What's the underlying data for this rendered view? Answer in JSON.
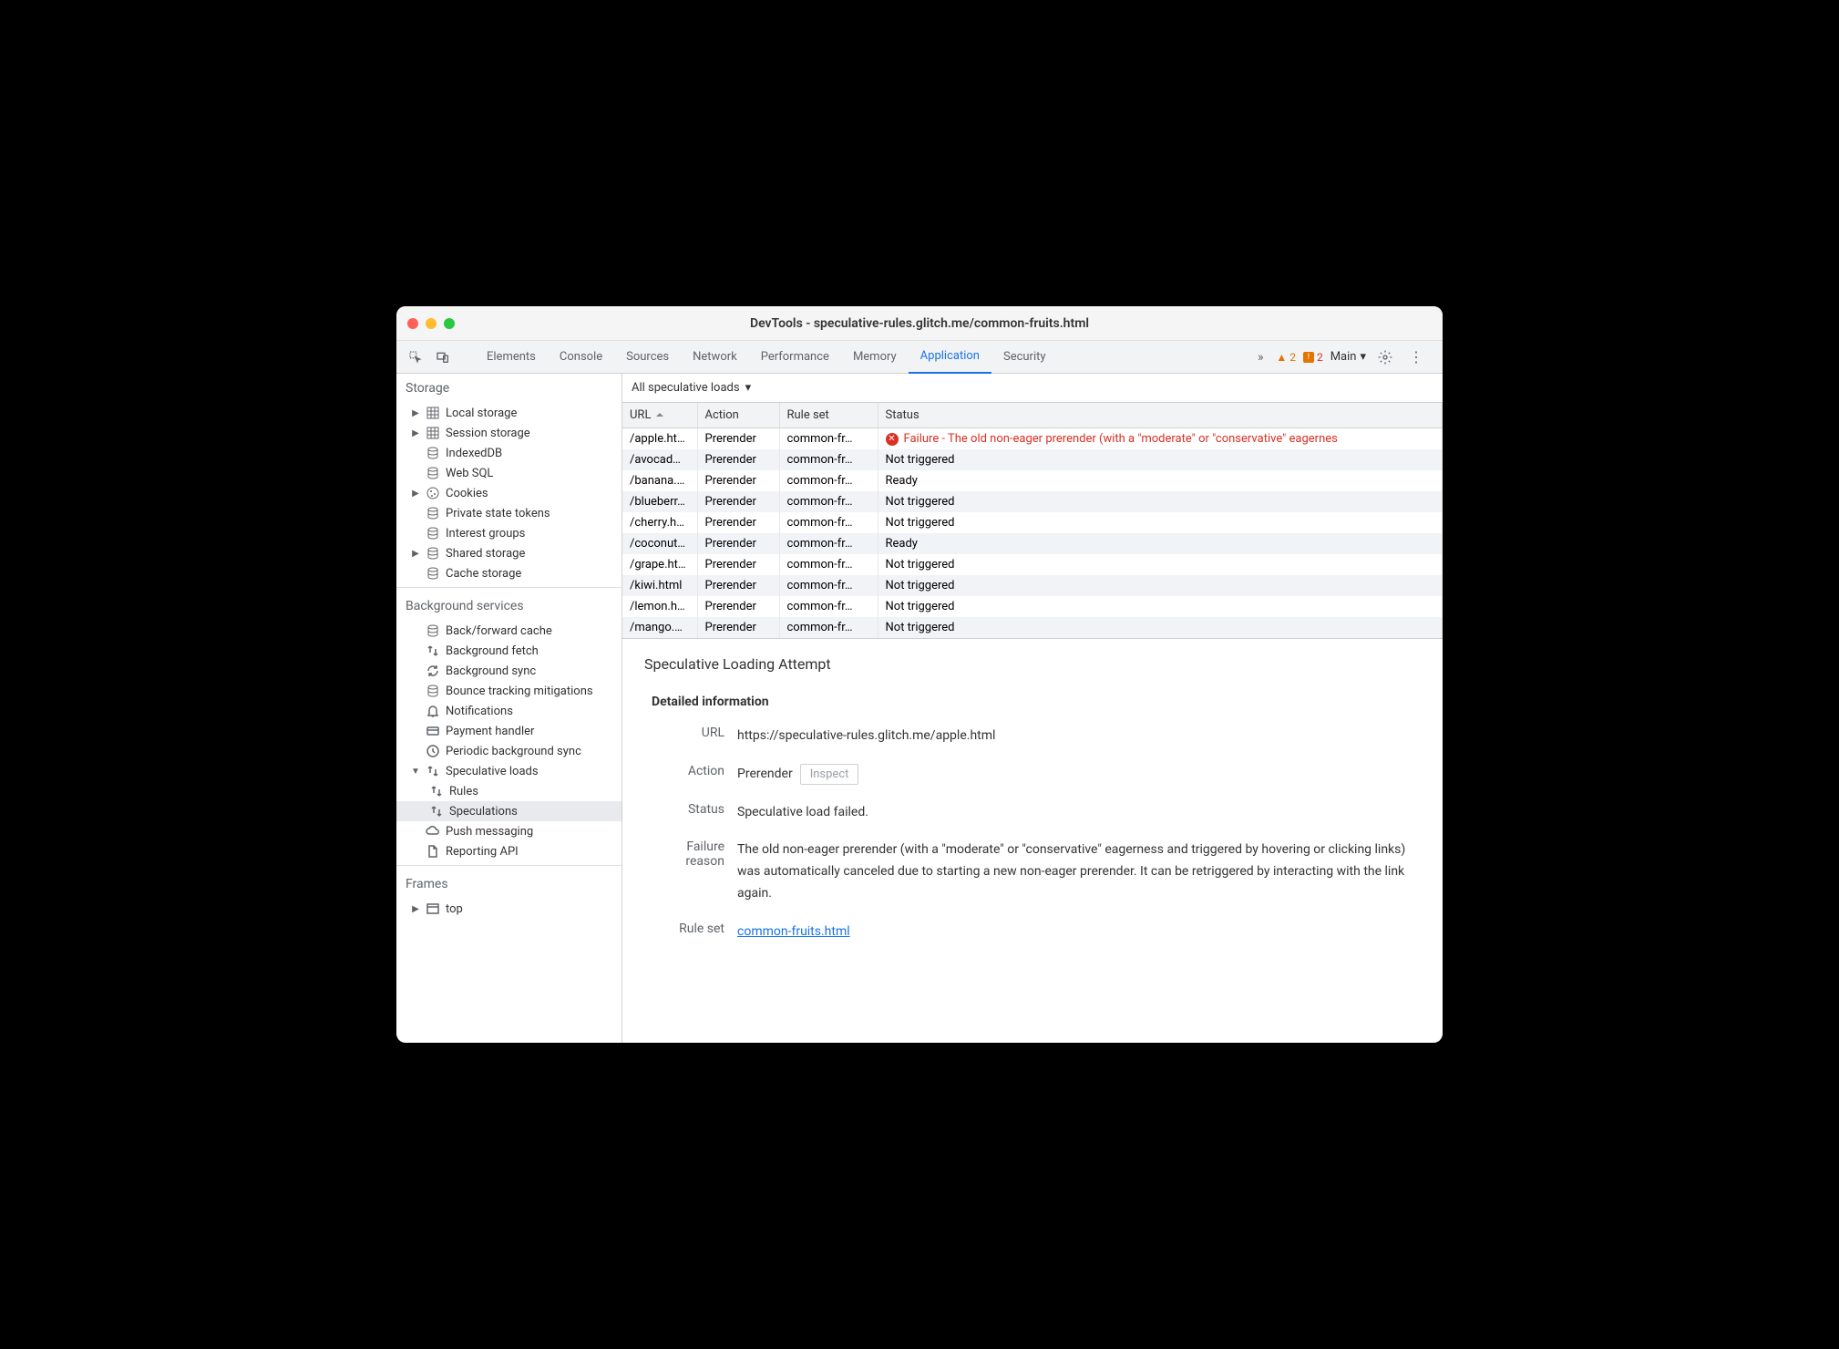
{
  "window": {
    "title": "DevTools - speculative-rules.glitch.me/common-fruits.html"
  },
  "toolbar": {
    "tabs": [
      "Elements",
      "Console",
      "Sources",
      "Network",
      "Performance",
      "Memory",
      "Application",
      "Security"
    ],
    "active_tab": "Application",
    "warnings": "2",
    "errors": "2",
    "main_label": "Main"
  },
  "sidebar": {
    "storage": {
      "title": "Storage",
      "items": [
        {
          "label": "Local storage",
          "icon": "grid",
          "expandable": true
        },
        {
          "label": "Session storage",
          "icon": "grid",
          "expandable": true
        },
        {
          "label": "IndexedDB",
          "icon": "db"
        },
        {
          "label": "Web SQL",
          "icon": "db"
        },
        {
          "label": "Cookies",
          "icon": "cookie",
          "expandable": true
        },
        {
          "label": "Private state tokens",
          "icon": "db"
        },
        {
          "label": "Interest groups",
          "icon": "db"
        },
        {
          "label": "Shared storage",
          "icon": "db",
          "expandable": true
        },
        {
          "label": "Cache storage",
          "icon": "db"
        }
      ]
    },
    "bg": {
      "title": "Background services",
      "items": [
        {
          "label": "Back/forward cache",
          "icon": "db"
        },
        {
          "label": "Background fetch",
          "icon": "updown"
        },
        {
          "label": "Background sync",
          "icon": "sync"
        },
        {
          "label": "Bounce tracking mitigations",
          "icon": "db"
        },
        {
          "label": "Notifications",
          "icon": "bell"
        },
        {
          "label": "Payment handler",
          "icon": "card"
        },
        {
          "label": "Periodic background sync",
          "icon": "clock"
        },
        {
          "label": "Speculative loads",
          "icon": "updown",
          "expandable": true,
          "expanded": true,
          "children": [
            {
              "label": "Rules",
              "icon": "updown"
            },
            {
              "label": "Speculations",
              "icon": "updown",
              "selected": true
            }
          ]
        },
        {
          "label": "Push messaging",
          "icon": "cloud"
        },
        {
          "label": "Reporting API",
          "icon": "doc"
        }
      ]
    },
    "frames": {
      "title": "Frames",
      "items": [
        {
          "label": "top",
          "icon": "frame",
          "expandable": true
        }
      ]
    }
  },
  "filter": {
    "label": "All speculative loads"
  },
  "table": {
    "headers": {
      "url": "URL",
      "action": "Action",
      "ruleset": "Rule set",
      "status": "Status"
    },
    "rows": [
      {
        "url": "/apple.html",
        "action": "Prerender",
        "ruleset": "common-fr…",
        "status": "Failure - The old non-eager prerender (with a \"moderate\" or \"conservative\" eagernes",
        "error": true
      },
      {
        "url": "/avocad…",
        "action": "Prerender",
        "ruleset": "common-fr…",
        "status": "Not triggered"
      },
      {
        "url": "/banana.…",
        "action": "Prerender",
        "ruleset": "common-fr…",
        "status": "Ready"
      },
      {
        "url": "/blueberr…",
        "action": "Prerender",
        "ruleset": "common-fr…",
        "status": "Not triggered"
      },
      {
        "url": "/cherry.h…",
        "action": "Prerender",
        "ruleset": "common-fr…",
        "status": "Not triggered"
      },
      {
        "url": "/coconut…",
        "action": "Prerender",
        "ruleset": "common-fr…",
        "status": "Ready"
      },
      {
        "url": "/grape.html",
        "action": "Prerender",
        "ruleset": "common-fr…",
        "status": "Not triggered"
      },
      {
        "url": "/kiwi.html",
        "action": "Prerender",
        "ruleset": "common-fr…",
        "status": "Not triggered"
      },
      {
        "url": "/lemon.h…",
        "action": "Prerender",
        "ruleset": "common-fr…",
        "status": "Not triggered"
      },
      {
        "url": "/mango.…",
        "action": "Prerender",
        "ruleset": "common-fr…",
        "status": "Not triggered"
      }
    ]
  },
  "details": {
    "title": "Speculative Loading Attempt",
    "section": "Detailed information",
    "url_label": "URL",
    "url": "https://speculative-rules.glitch.me/apple.html",
    "action_label": "Action",
    "action": "Prerender",
    "inspect": "Inspect",
    "status_label": "Status",
    "status": "Speculative load failed.",
    "failure_label": "Failure reason",
    "failure": "The old non-eager prerender (with a \"moderate\" or \"conservative\" eagerness and triggered by hovering or clicking links) was automatically canceled due to starting a new non-eager prerender. It can be retriggered by interacting with the link again.",
    "ruleset_label": "Rule set",
    "ruleset": "common-fruits.html"
  }
}
